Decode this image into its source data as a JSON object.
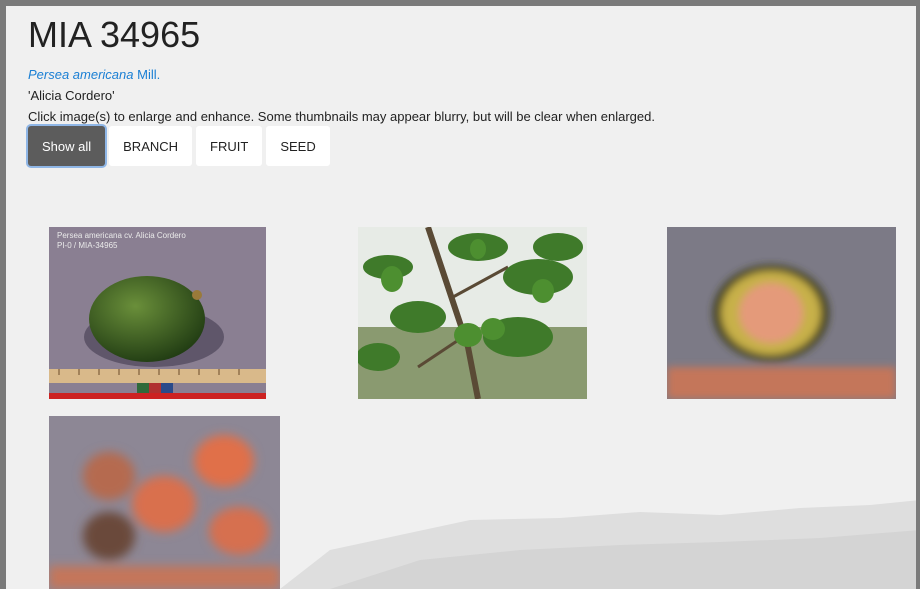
{
  "header": {
    "title": "MIA 34965",
    "species_italic": "Persea americana",
    "species_author": "Mill.",
    "cultivar": "'Alicia Cordero'",
    "hint": "Click image(s) to enlarge and enhance. Some thumbnails may appear blurry, but will be clear when enlarged."
  },
  "filters": [
    {
      "label": "Show all",
      "active": true
    },
    {
      "label": "BRANCH",
      "active": false
    },
    {
      "label": "FRUIT",
      "active": false
    },
    {
      "label": "SEED",
      "active": false
    }
  ],
  "thumbnails": [
    {
      "kind": "fruit-whole",
      "caption_line1": "Persea americana  cv. Alicia Cordero",
      "caption_line2": "PI-0 / MIA-34965"
    },
    {
      "kind": "branch"
    },
    {
      "kind": "fruit-cut"
    },
    {
      "kind": "seeds"
    }
  ],
  "colors": {
    "link": "#1a7fd4",
    "active_button": "#5c5c5c",
    "background": "#f0f0f0"
  }
}
